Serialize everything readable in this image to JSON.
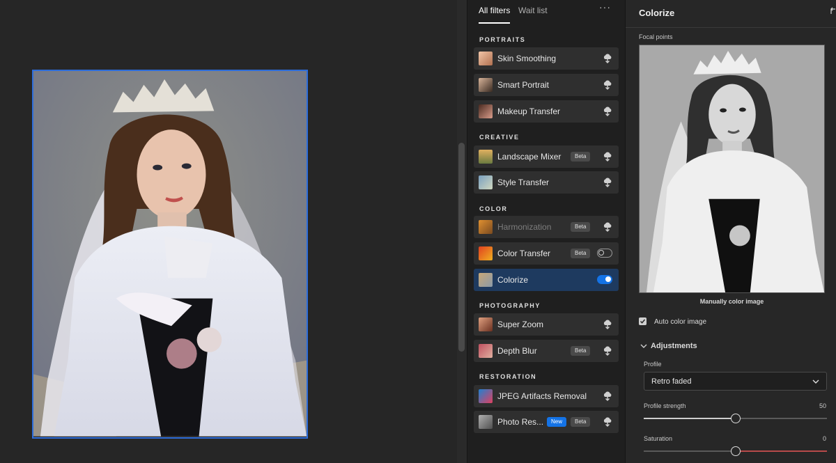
{
  "tabs": {
    "all_filters": "All filters",
    "wait_list": "Wait list",
    "more": "···"
  },
  "sections": [
    {
      "title": "PORTRAITS",
      "items": [
        {
          "label": "Skin Smoothing",
          "thumb": "face-thumb",
          "action": "cloud-download-icon"
        },
        {
          "label": "Smart Portrait",
          "thumb": "face-thumb",
          "action": "cloud-download-icon"
        },
        {
          "label": "Makeup Transfer",
          "thumb": "face-thumb",
          "action": "cloud-download-icon"
        }
      ]
    },
    {
      "title": "CREATIVE",
      "items": [
        {
          "label": "Landscape Mixer",
          "badge": "Beta",
          "thumb": "landscape-thumb",
          "action": "cloud-download-icon"
        },
        {
          "label": "Style Transfer",
          "thumb": "style-thumb",
          "action": "cloud-download-icon"
        }
      ]
    },
    {
      "title": "COLOR",
      "items": [
        {
          "label": "Harmonization",
          "badge": "Beta",
          "disabled": true,
          "thumb": "harmonization-thumb",
          "action": "cloud-download-icon"
        },
        {
          "label": "Color Transfer",
          "badge": "Beta",
          "thumb": "color-transfer-thumb",
          "action": "toggle",
          "enabled": false
        },
        {
          "label": "Colorize",
          "thumb": "colorize-thumb",
          "action": "toggle",
          "enabled": true,
          "selected": true
        }
      ]
    },
    {
      "title": "PHOTOGRAPHY",
      "items": [
        {
          "label": "Super Zoom",
          "thumb": "face-thumb",
          "action": "cloud-download-icon"
        },
        {
          "label": "Depth Blur",
          "badge": "Beta",
          "thumb": "face-thumb",
          "action": "cloud-download-icon"
        }
      ]
    },
    {
      "title": "RESTORATION",
      "items": [
        {
          "label": "JPEG Artifacts Removal",
          "thumb": "jpeg-thumb",
          "action": "cloud-download-icon"
        },
        {
          "label": "Photo Res...",
          "badge_new": "New",
          "badge": "Beta",
          "thumb": "photo-restore-thumb",
          "action": "cloud-download-icon"
        }
      ]
    }
  ],
  "properties": {
    "title": "Colorize",
    "focal_points_label": "Focal points",
    "manual_color_label": "Manually color image",
    "auto_color_label": "Auto color image",
    "auto_color_checked": true,
    "adjustments_label": "Adjustments",
    "profile_label": "Profile",
    "profile_value": "Retro faded",
    "profile_strength": {
      "label": "Profile strength",
      "value": "50",
      "fraction": 0.5
    },
    "saturation": {
      "label": "Saturation",
      "value": "0",
      "fraction": 0.5
    }
  },
  "colors": {
    "accent": "#1473e6",
    "selection_border": "#2d6ddb",
    "selected_row": "#1e3a5f",
    "saturation_fill": "#b84a4a"
  }
}
